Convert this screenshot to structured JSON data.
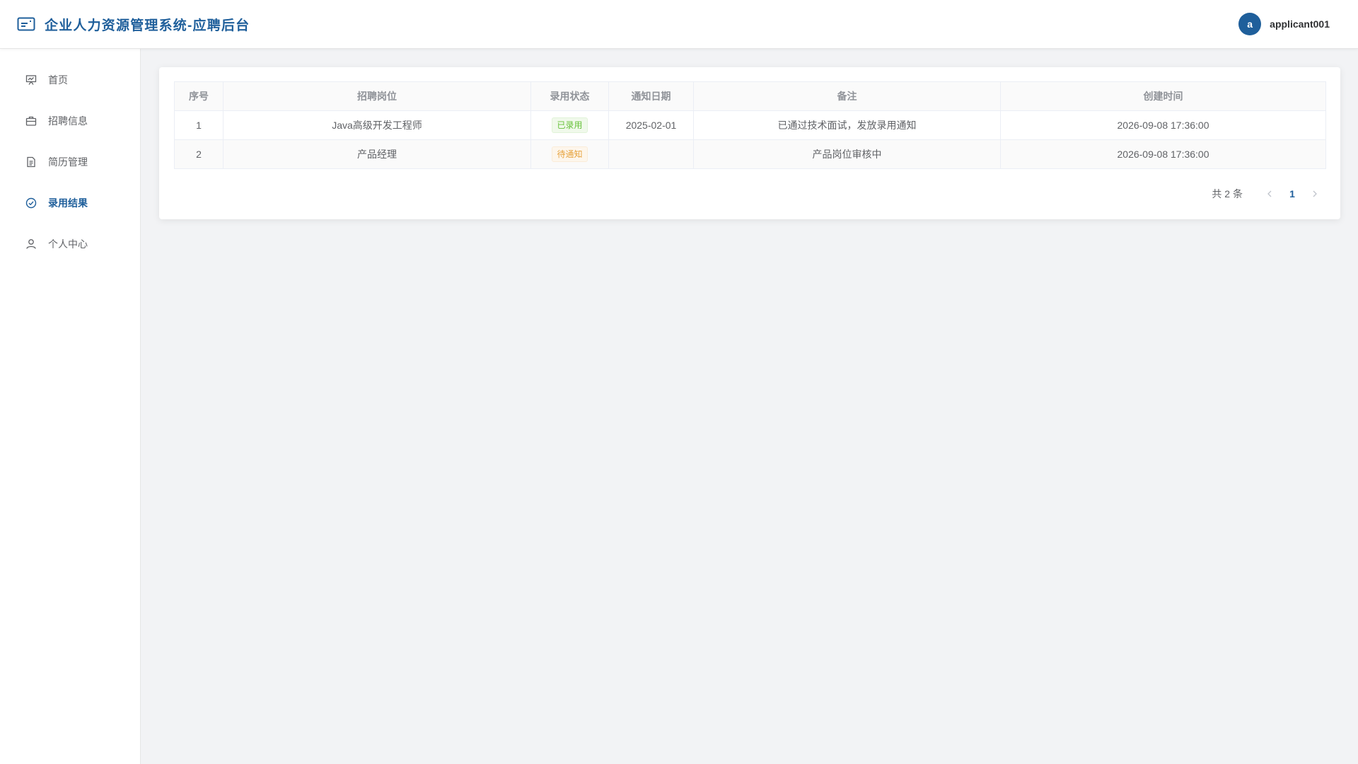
{
  "header": {
    "brand_icon": "id-card-icon",
    "title": "企业人力资源管理系统-应聘后台",
    "user_initial": "a",
    "username": "applicant001"
  },
  "sidebar": {
    "items": [
      {
        "label": "首页",
        "icon": "presentation-icon",
        "active": false
      },
      {
        "label": "招聘信息",
        "icon": "briefcase-icon",
        "active": false
      },
      {
        "label": "简历管理",
        "icon": "document-icon",
        "active": false
      },
      {
        "label": "录用结果",
        "icon": "check-circle-icon",
        "active": true
      },
      {
        "label": "个人中心",
        "icon": "user-icon",
        "active": false
      }
    ]
  },
  "table": {
    "headers": [
      "序号",
      "招聘岗位",
      "录用状态",
      "通知日期",
      "备注",
      "创建时间"
    ],
    "rows": [
      {
        "index": "1",
        "position": "Java高级开发工程师",
        "status": "已录用",
        "status_type": "success",
        "notice_date": "2025-02-01",
        "remark": "已通过技术面试，发放录用通知",
        "created_at": "2026-09-08 17:36:00"
      },
      {
        "index": "2",
        "position": "产品经理",
        "status": "待通知",
        "status_type": "warning",
        "notice_date": "",
        "remark": "产品岗位审核中",
        "created_at": "2026-09-08 17:36:00"
      }
    ]
  },
  "pagination": {
    "total_text": "共 2 条",
    "current_page": "1",
    "prev_icon": "chevron-left-icon",
    "next_icon": "chevron-right-icon"
  },
  "colors": {
    "primary": "#1f5f9b",
    "success": "#67c23a",
    "warning": "#e6a23c"
  }
}
